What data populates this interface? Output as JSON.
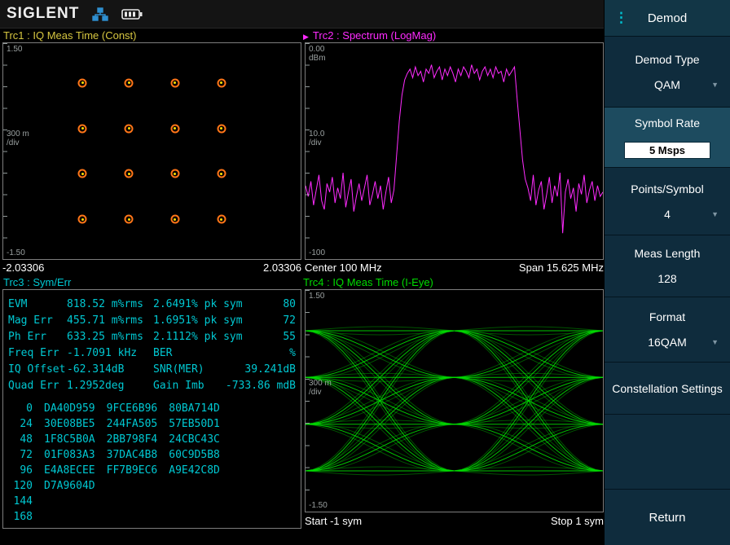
{
  "theme": {
    "topbar_bg": "#141414",
    "sidebar_bg": "#0f2c3d",
    "sidebar_head_bg": "#123646",
    "sidebar_selected_bg": "#1d4b5f",
    "sidebar_divider": "#03141e",
    "plot_border": "#7d7d7d",
    "axis_label": "#9aa0a0",
    "trc1_color": "#d6c640",
    "trc2_color": "#ff2bff",
    "trc3_color": "#00c8d2",
    "trc4_color": "#00dc00",
    "const_ring": "#ff7518",
    "const_dot": "#ffe000"
  },
  "icons": {
    "trace_marker": "▶",
    "dropdown": "▼",
    "menu_dots": "⋮"
  },
  "topbar": {
    "logo": "SIGLENT"
  },
  "trc1": {
    "title": "Trc1 : IQ Meas Time (Const)",
    "y_top": "1.50",
    "y_div": "300 m",
    "y_div_unit": "/div",
    "y_bottom": "-1.50",
    "x_left": "-2.03306",
    "x_right": "2.03306"
  },
  "trc2": {
    "title": "Trc2 : Spectrum (LogMag)",
    "y_top": "0.00",
    "y_top_unit": "dBm",
    "y_div": "10.0",
    "y_div_unit": "/div",
    "y_bottom": "-100",
    "x_left": "Center 100 MHz",
    "x_right": "Span 15.625 MHz"
  },
  "trc3": {
    "title": "Trc3 : Sym/Err",
    "err_rows": [
      [
        "EVM",
        "818.52 m%rms",
        "2.6491% pk sym",
        "80"
      ],
      [
        "Mag Err",
        "455.71 m%rms",
        "1.6951% pk sym",
        "72"
      ],
      [
        "Ph Err",
        "633.25 m%rms",
        "2.1112% pk sym",
        "55"
      ],
      [
        "Freq Err",
        "-1.7091 kHz",
        "BER",
        "%"
      ],
      [
        "IQ Offset",
        "-62.314dB",
        "SNR(MER)",
        "39.241dB"
      ],
      [
        "Quad Err",
        "1.2952deg",
        "Gain Imb",
        "-733.86 mdB"
      ]
    ],
    "hex_rows": [
      {
        "index": "0",
        "groups": [
          "DA40D959",
          "9FCE6B96",
          "80BA714D"
        ]
      },
      {
        "index": "24",
        "groups": [
          "30E08BE5",
          "244FA505",
          "57EB50D1"
        ]
      },
      {
        "index": "48",
        "groups": [
          "1F8C5B0A",
          "2BB798F4",
          "24CBC43C"
        ]
      },
      {
        "index": "72",
        "groups": [
          "01F083A3",
          "37DAC4B8",
          "60C9D5B8"
        ]
      },
      {
        "index": "96",
        "groups": [
          "E4A8ECEE",
          "FF7B9EC6",
          "A9E42C8D"
        ]
      },
      {
        "index": "120",
        "groups": [
          "D7A9604D"
        ]
      },
      {
        "index": "144",
        "groups": []
      },
      {
        "index": "168",
        "groups": []
      }
    ]
  },
  "trc4": {
    "title": "Trc4 : IQ Meas Time (I-Eye)",
    "y_top": "1.50",
    "y_div": "300 m",
    "y_div_unit": "/div",
    "y_bottom": "-1.50",
    "x_left": "Start -1 sym",
    "x_right": "Stop 1 sym"
  },
  "sidebar": {
    "menu_title": "Demod",
    "items": [
      {
        "label": "Demod Type",
        "value": "QAM",
        "dropdown": true
      },
      {
        "label": "Symbol Rate",
        "value": "5 Msps",
        "editable": true,
        "selected": true
      },
      {
        "label": "Points/Symbol",
        "value": "4",
        "dropdown": true
      },
      {
        "label": "Meas Length",
        "value": "128"
      },
      {
        "label": "Format",
        "value": "16QAM",
        "dropdown": true
      },
      {
        "label": "Constellation Settings"
      }
    ],
    "return_label": "Return"
  },
  "chart_data": [
    {
      "type": "scatter",
      "name": "constellation",
      "title": "Trc1: IQ Meas Time (Const)",
      "xlim": [
        -2.03306,
        2.03306
      ],
      "ylim": [
        -1.5,
        1.5
      ],
      "levels": [
        -0.9487,
        -0.3162,
        0.3162,
        0.9487
      ],
      "ylabel_scale": "300 m/div"
    },
    {
      "type": "line",
      "name": "spectrum",
      "title": "Trc2: Spectrum (LogMag)",
      "center": "100 MHz",
      "span": "15.625 MHz",
      "ref_level_dbm": 0,
      "scale_db_per_div": 10,
      "ylim": [
        -100,
        0
      ],
      "y_values": [
        -66,
        -71,
        -64,
        -75,
        -68,
        -61,
        -73,
        -77,
        -65,
        -69,
        -62,
        -74,
        -67,
        -72,
        -60,
        -76,
        -69,
        -63,
        -78,
        -71,
        -65,
        -73,
        -67,
        -61,
        -75,
        -70,
        -64,
        -72,
        -66,
        -77,
        -69,
        -62,
        -74,
        -68,
        -52,
        -36,
        -24,
        -17,
        -14,
        -12,
        -16,
        -11,
        -15,
        -13,
        -18,
        -12,
        -14,
        -10,
        -16,
        -13,
        -11,
        -17,
        -12,
        -15,
        -11,
        -14,
        -18,
        -12,
        -15,
        -11,
        -13,
        -16,
        -10,
        -14,
        -12,
        -17,
        -13,
        -11,
        -15,
        -12,
        -16,
        -11,
        -14,
        -13,
        -18,
        -12,
        -15,
        -13,
        -11,
        -26,
        -40,
        -54,
        -63,
        -67,
        -73,
        -61,
        -75,
        -68,
        -64,
        -77,
        -70,
        -62,
        -74,
        -66,
        -71,
        -60,
        -88,
        -69,
        -63,
        -72,
        -67,
        -78,
        -65,
        -70,
        -61,
        -74,
        -68,
        -64,
        -73,
        -66,
        -71,
        -69
      ]
    },
    {
      "type": "line",
      "name": "eye",
      "title": "Trc4: IQ Meas Time (I-Eye)",
      "xlim_sym": [
        -1,
        1
      ],
      "ylim": [
        -1.5,
        1.5
      ],
      "levels": [
        -0.9487,
        -0.3162,
        0.3162,
        0.9487
      ],
      "ylabel_scale": "300 m/div"
    }
  ]
}
